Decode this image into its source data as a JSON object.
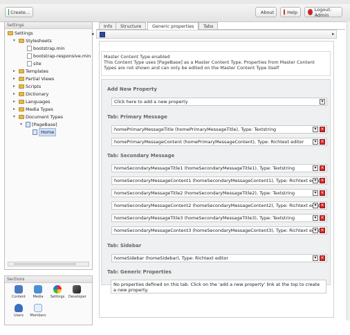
{
  "topbar": {
    "create_label": "Create...",
    "about_label": "About",
    "help_label": "Help",
    "logout_label": "Logout: Admin"
  },
  "left": {
    "panel_title": "Settings",
    "tree": [
      {
        "label": "Settings"
      },
      {
        "label": "Stylesheets"
      },
      {
        "label": "bootstrap.min"
      },
      {
        "label": "bootstrap-responsive.min"
      },
      {
        "label": "site"
      },
      {
        "label": "Templates"
      },
      {
        "label": "Partial Views"
      },
      {
        "label": "Scripts"
      },
      {
        "label": "Dictionary"
      },
      {
        "label": "Languages"
      },
      {
        "label": "Media Types"
      },
      {
        "label": "Document Types"
      },
      {
        "label": "[PageBase]"
      },
      {
        "label": "Home"
      }
    ]
  },
  "sections": {
    "title": "Sections",
    "items": [
      {
        "label": "Content"
      },
      {
        "label": "Media"
      },
      {
        "label": "Settings"
      },
      {
        "label": "Developer"
      },
      {
        "label": "Users"
      },
      {
        "label": "Members"
      }
    ]
  },
  "main": {
    "tabs": [
      {
        "label": "Info"
      },
      {
        "label": "Structure"
      },
      {
        "label": "Generic properties"
      },
      {
        "label": "Tabs"
      }
    ],
    "notice": {
      "title": "Master Content Type enabled",
      "text": "This Content Type uses [PageBase] as a Master Content Type. Properties from Master Content Types are not shown and can only be edited on the Master Content Type itself"
    },
    "add_new_property": {
      "heading": "Add New Property",
      "select_label": "Click here to add a new property"
    },
    "tab_primary": {
      "heading": "Tab: Primary Message",
      "rows": [
        {
          "text": "homePrimaryMessageTitle (homePrimaryMessageTitle), Type: Textstring"
        },
        {
          "text": "homePrimaryMessageContent (homePrimaryMessageContent), Type: Richtext editor"
        }
      ]
    },
    "tab_secondary": {
      "heading": "Tab: Secondary Message",
      "rows": [
        {
          "text": "homeSecondaryMessageTitle1 (homeSecondaryMessageTitle1), Type: Textstring"
        },
        {
          "text": "homeSecondaryMessageContent1 (homeSecondaryMessageContent1), Type: Richtext editor"
        },
        {
          "text": "homeSecondaryMessageTitle2 (homeSecondaryMessageTitle2), Type: Textstring"
        },
        {
          "text": "homeSecondaryMessageContent2 (homeSecondaryMessageContent2), Type: Richtext editor"
        },
        {
          "text": "homeSecondaryMessageTitle3 (homeSecondaryMessageTitle3), Type: Textstring"
        },
        {
          "text": "homeSecondaryMessageContent3 (homeSecondaryMessageContent3), Type: Richtext editor"
        }
      ]
    },
    "tab_sidebar": {
      "heading": "Tab: Sidebar",
      "rows": [
        {
          "text": "homeSidebar (homeSidebar), Type: Richtext editor"
        }
      ]
    },
    "tab_generic": {
      "heading": "Tab: Generic Properties",
      "note": "No properties defined on this tab. Click on the 'add a new property' link at the top to create a new property."
    }
  },
  "colors": {
    "accent": "#2f6fb0",
    "delete": "#d62b2b",
    "folder": "#e6b84d"
  }
}
